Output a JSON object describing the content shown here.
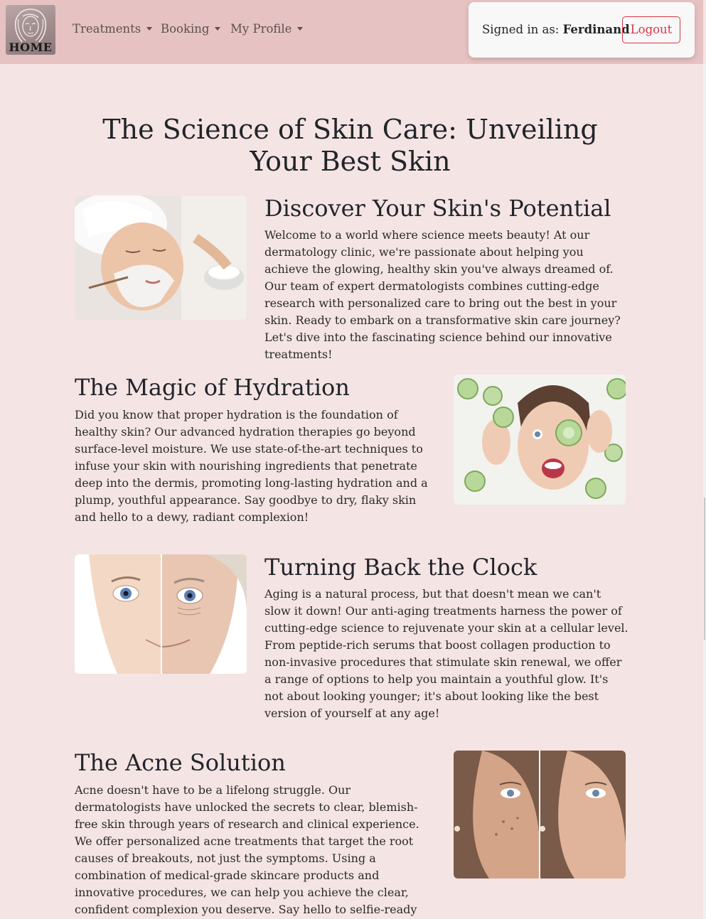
{
  "nav": {
    "logo_text": "HOME",
    "items": [
      {
        "label": "Treatments"
      },
      {
        "label": "Booking"
      },
      {
        "label": "My Profile"
      }
    ],
    "signed_in_label": "Signed in as:",
    "user_name": "Ferdinand",
    "logout_label": "Logout"
  },
  "page": {
    "title": "The Science of Skin Care: Unveiling Your Best Skin"
  },
  "sections": [
    {
      "title": "Discover Your Skin's Potential",
      "text": "Welcome to a world where science meets beauty! At our dermatology clinic, we're passionate about helping you achieve the glowing, healthy skin you've always dreamed of. Our team of expert dermatologists combines cutting-edge research with personalized care to bring out the best in your skin. Ready to embark on a transformative skin care journey? Let's dive into the fascinating science behind our innovative treatments!"
    },
    {
      "title": "The Magic of Hydration",
      "text": "Did you know that proper hydration is the foundation of healthy skin? Our advanced hydration therapies go beyond surface-level moisture. We use state-of-the-art techniques to infuse your skin with nourishing ingredients that penetrate deep into the dermis, promoting long-lasting hydration and a plump, youthful appearance. Say goodbye to dry, flaky skin and hello to a dewy, radiant complexion!"
    },
    {
      "title": "Turning Back the Clock",
      "text": "Aging is a natural process, but that doesn't mean we can't slow it down! Our anti-aging treatments harness the power of cutting-edge science to rejuvenate your skin at a cellular level. From peptide-rich serums that boost collagen production to non-invasive procedures that stimulate skin renewal, we offer a range of options to help you maintain a youthful glow. It's not about looking younger; it's about looking like the best version of yourself at any age!"
    },
    {
      "title": "The Acne Solution",
      "text": "Acne doesn't have to be a lifelong struggle. Our dermatologists have unlocked the secrets to clear, blemish-free skin through years of research and clinical experience. We offer personalized acne treatments that target the root causes of breakouts, not just the symptoms. Using a combination of medical-grade skincare products and innovative procedures, we can help you achieve the clear, confident complexion you deserve. Say hello to selfie-ready skin!"
    }
  ],
  "colors": {
    "page_bg": "#f5e4e4",
    "navbar_bg": "#e7c2c2",
    "logout": "#dc3545"
  }
}
